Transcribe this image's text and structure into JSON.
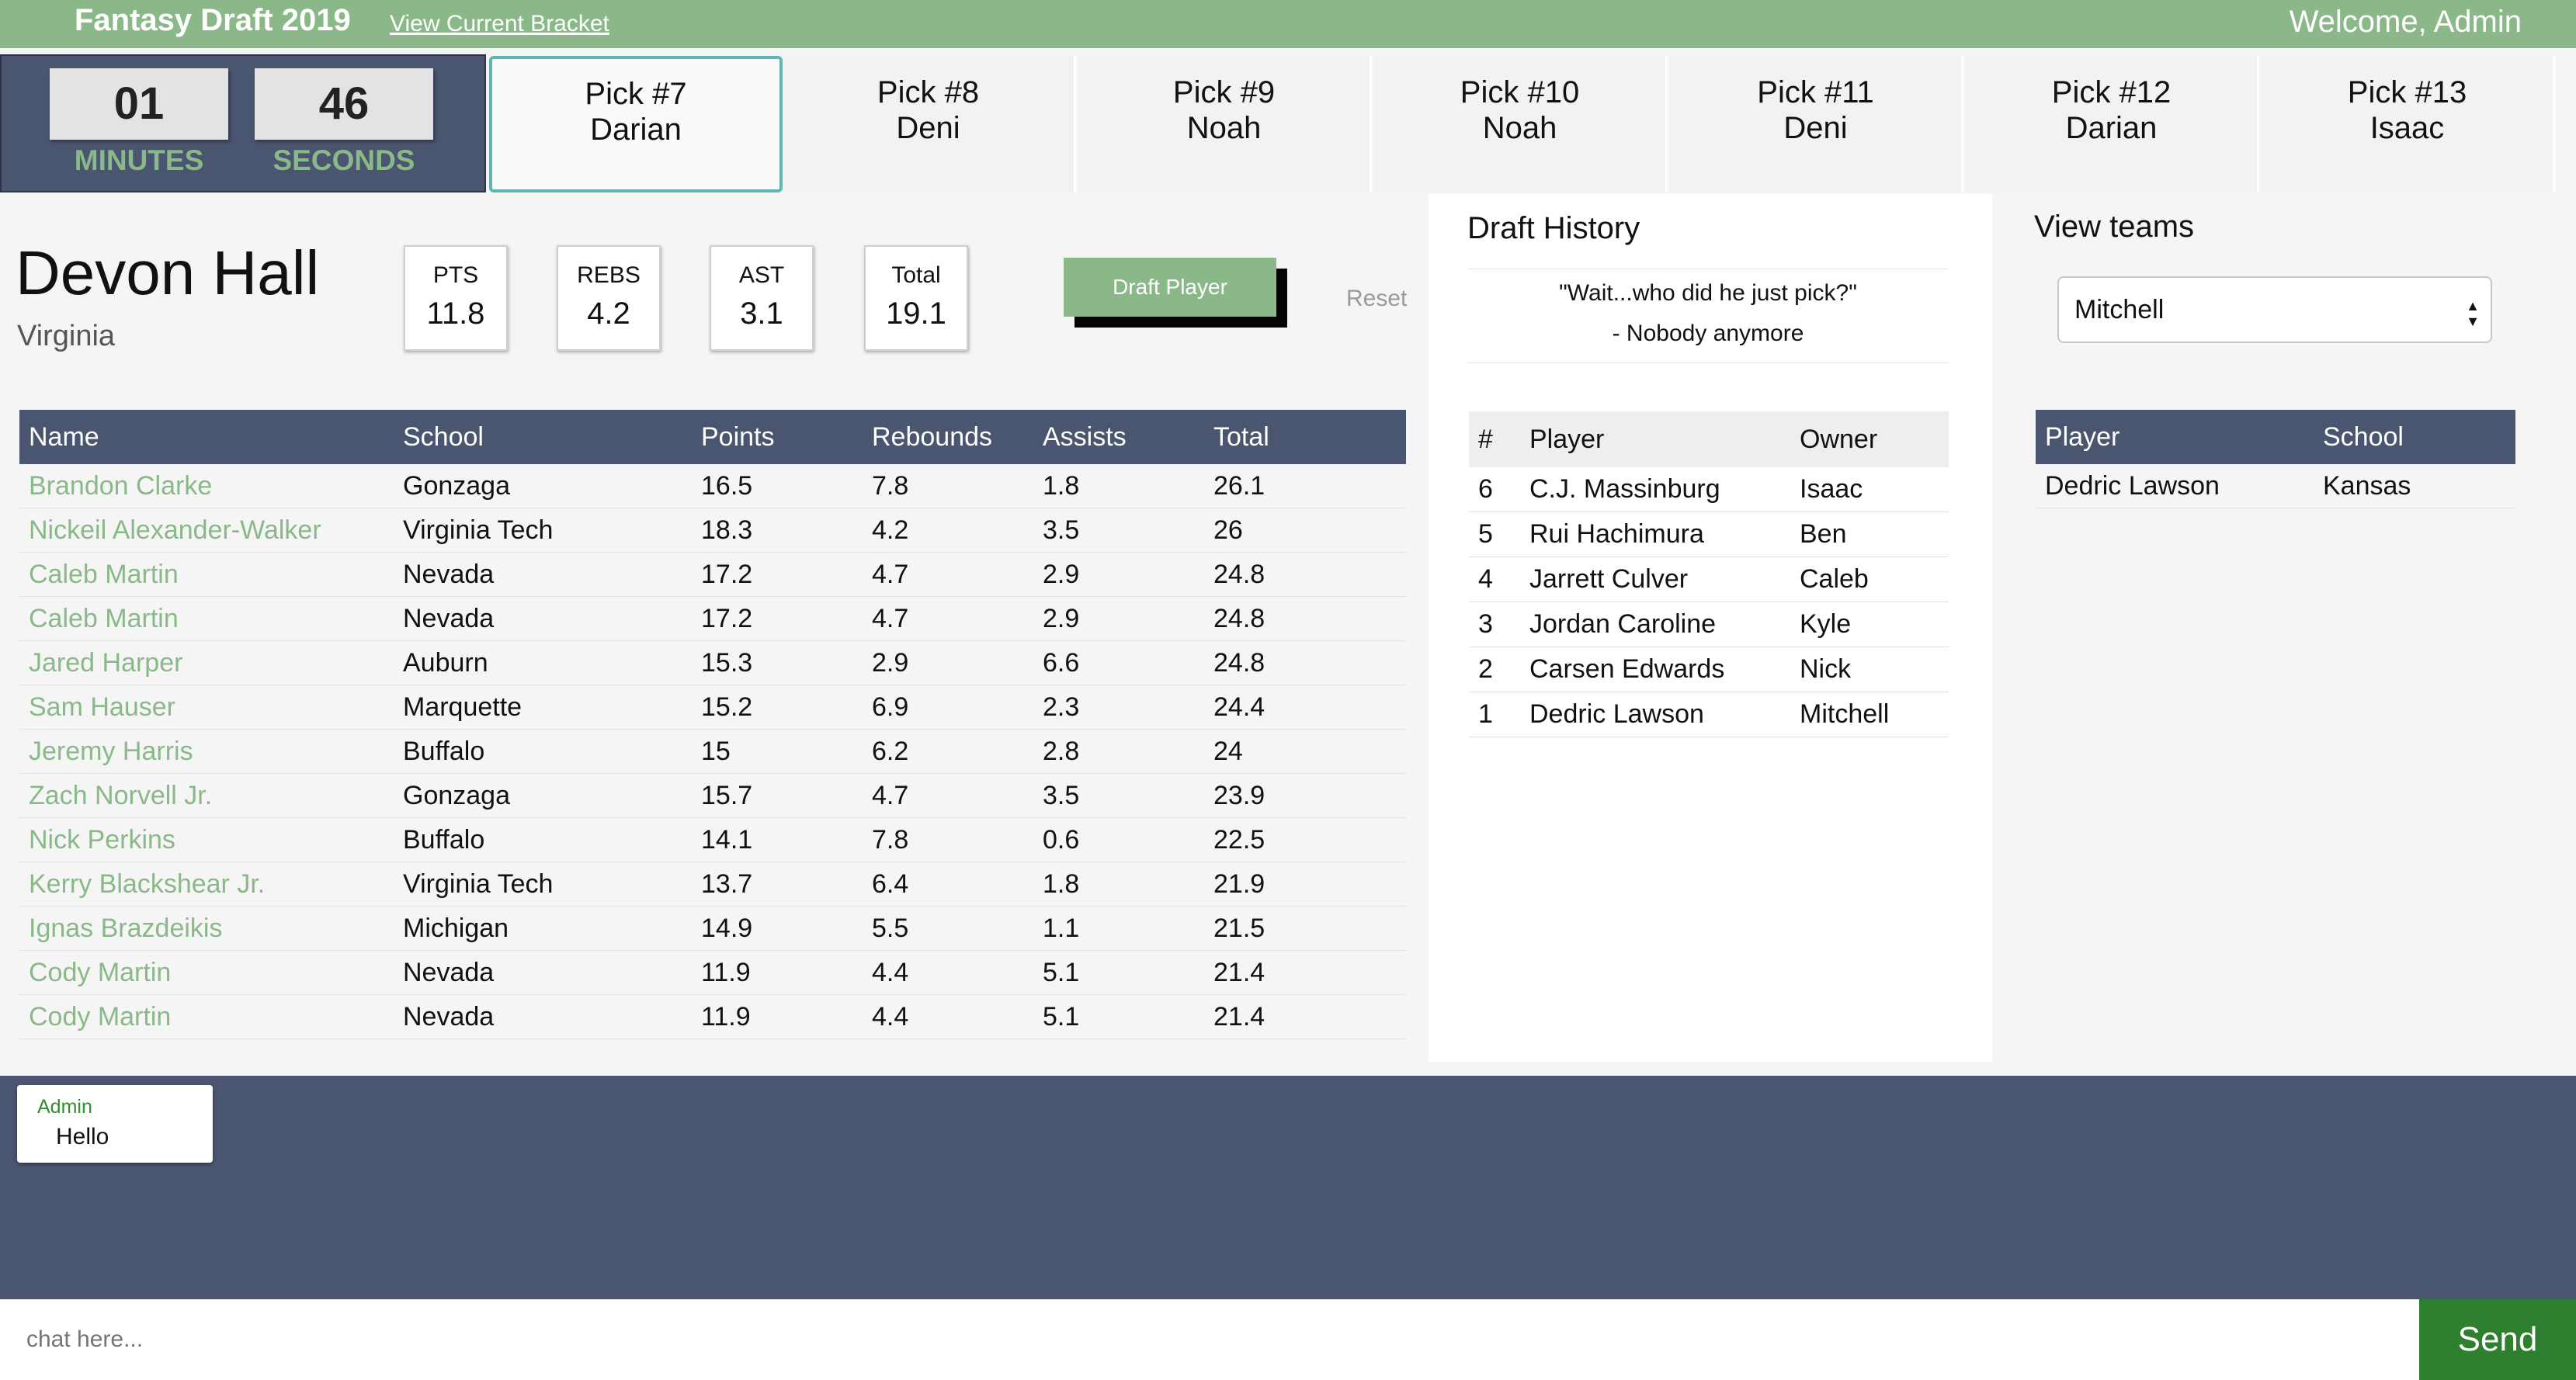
{
  "header": {
    "title": "Fantasy Draft 2019",
    "bracket_link": "View Current Bracket",
    "welcome": "Welcome, Admin"
  },
  "timer": {
    "minutes": "01",
    "minutes_label": "MINUTES",
    "seconds": "46",
    "seconds_label": "SECONDS"
  },
  "picks": [
    {
      "label": "Pick #7",
      "owner": "Darian",
      "active": true
    },
    {
      "label": "Pick #8",
      "owner": "Deni"
    },
    {
      "label": "Pick #9",
      "owner": "Noah"
    },
    {
      "label": "Pick #10",
      "owner": "Noah"
    },
    {
      "label": "Pick #11",
      "owner": "Deni"
    },
    {
      "label": "Pick #12",
      "owner": "Darian"
    },
    {
      "label": "Pick #13",
      "owner": "Isaac"
    }
  ],
  "player": {
    "name": "Devon Hall",
    "school": "Virginia",
    "stats": [
      {
        "label": "PTS",
        "value": "11.8"
      },
      {
        "label": "REBS",
        "value": "4.2"
      },
      {
        "label": "AST",
        "value": "3.1"
      },
      {
        "label": "Total",
        "value": "19.1"
      }
    ],
    "draft_button": "Draft Player",
    "reset": "Reset"
  },
  "players_table": {
    "headers": [
      "Name",
      "School",
      "Points",
      "Rebounds",
      "Assists",
      "Total"
    ],
    "rows": [
      [
        "Brandon Clarke",
        "Gonzaga",
        "16.5",
        "7.8",
        "1.8",
        "26.1"
      ],
      [
        "Nickeil Alexander-Walker",
        "Virginia Tech",
        "18.3",
        "4.2",
        "3.5",
        "26"
      ],
      [
        "Caleb Martin",
        "Nevada",
        "17.2",
        "4.7",
        "2.9",
        "24.8"
      ],
      [
        "Caleb Martin",
        "Nevada",
        "17.2",
        "4.7",
        "2.9",
        "24.8"
      ],
      [
        "Jared Harper",
        "Auburn",
        "15.3",
        "2.9",
        "6.6",
        "24.8"
      ],
      [
        "Sam Hauser",
        "Marquette",
        "15.2",
        "6.9",
        "2.3",
        "24.4"
      ],
      [
        "Jeremy Harris",
        "Buffalo",
        "15",
        "6.2",
        "2.8",
        "24"
      ],
      [
        "Zach Norvell Jr.",
        "Gonzaga",
        "15.7",
        "4.7",
        "3.5",
        "23.9"
      ],
      [
        "Nick Perkins",
        "Buffalo",
        "14.1",
        "7.8",
        "0.6",
        "22.5"
      ],
      [
        "Kerry Blackshear Jr.",
        "Virginia Tech",
        "13.7",
        "6.4",
        "1.8",
        "21.9"
      ],
      [
        "Ignas Brazdeikis",
        "Michigan",
        "14.9",
        "5.5",
        "1.1",
        "21.5"
      ],
      [
        "Cody Martin",
        "Nevada",
        "11.9",
        "4.4",
        "5.1",
        "21.4"
      ],
      [
        "Cody Martin",
        "Nevada",
        "11.9",
        "4.4",
        "5.1",
        "21.4"
      ]
    ]
  },
  "history": {
    "title": "Draft History",
    "quote": "\"Wait...who did he just pick?\"",
    "quote_author": "- Nobody anymore",
    "headers": [
      "#",
      "Player",
      "Owner"
    ],
    "rows": [
      [
        "6",
        "C.J. Massinburg",
        "Isaac"
      ],
      [
        "5",
        "Rui Hachimura",
        "Ben"
      ],
      [
        "4",
        "Jarrett Culver",
        "Caleb"
      ],
      [
        "3",
        "Jordan Caroline",
        "Kyle"
      ],
      [
        "2",
        "Carsen Edwards",
        "Nick"
      ],
      [
        "1",
        "Dedric Lawson",
        "Mitchell"
      ]
    ]
  },
  "teams": {
    "title": "View teams",
    "selected": "Mitchell",
    "arrow_icon": "updown-arrows-icon",
    "headers": [
      "Player",
      "School"
    ],
    "rows": [
      [
        "Dedric Lawson",
        "Kansas"
      ]
    ]
  },
  "chat": {
    "messages": [
      {
        "author": "Admin",
        "text": "Hello"
      }
    ],
    "placeholder": "chat here...",
    "send_label": "Send"
  },
  "colors": {
    "accent_green": "#8bb889",
    "navy": "#4a566f",
    "send_green": "#2f7f31",
    "active_pick_border": "#5fb6b0"
  }
}
